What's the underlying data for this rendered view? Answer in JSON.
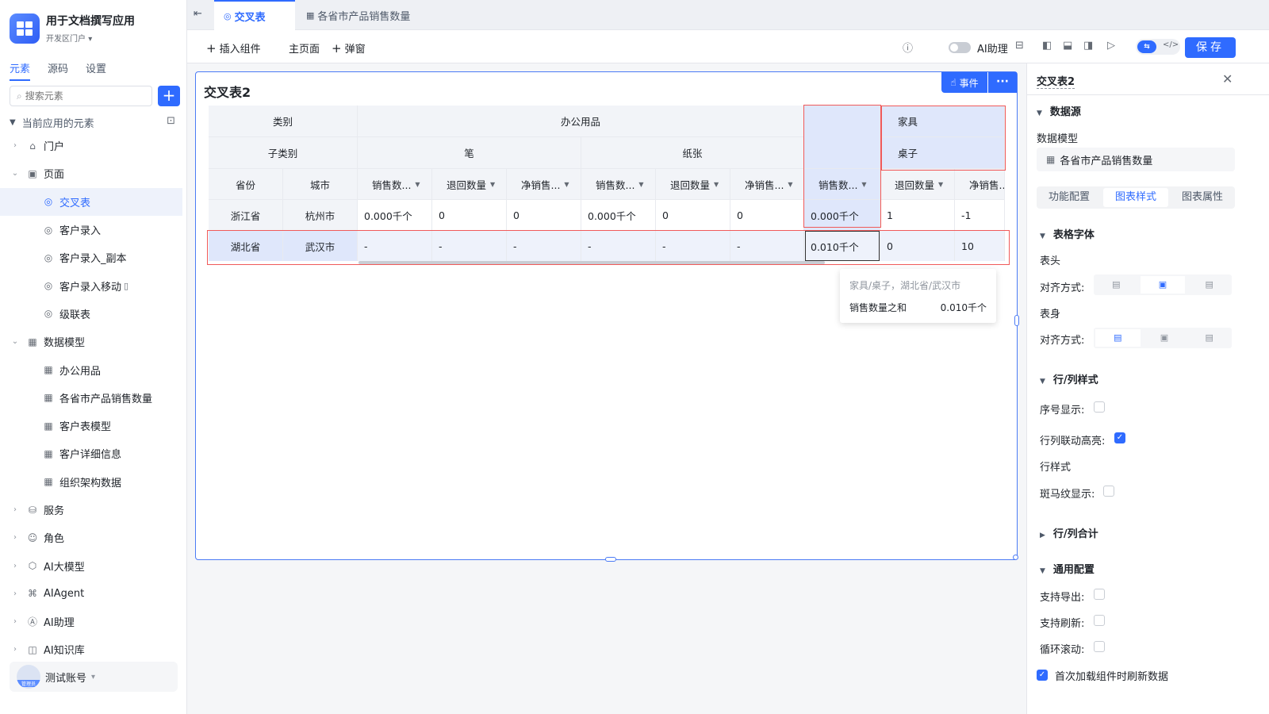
{
  "app": {
    "title": "用于文档撰写应用",
    "portal": "开发区门户"
  },
  "sidebar": {
    "tabs": [
      "元素",
      "源码",
      "设置"
    ],
    "search_placeholder": "搜索元素",
    "add": "+",
    "tree_root": "当前应用的元素",
    "items": [
      {
        "label": "门户",
        "icon": "portal-icon",
        "arrow": "›"
      },
      {
        "label": "页面",
        "icon": "page-icon",
        "arrow": "⌄"
      },
      {
        "label": "交叉表",
        "icon": "cross-table-icon"
      },
      {
        "label": "客户录入",
        "icon": "form-icon"
      },
      {
        "label": "客户录入_副本",
        "icon": "form-icon"
      },
      {
        "label": "客户录入移动",
        "icon": "form-icon"
      },
      {
        "label": "级联表",
        "icon": "form-icon"
      },
      {
        "label": "数据模型",
        "icon": "table-icon",
        "arrow": "⌄"
      },
      {
        "label": "办公用品",
        "icon": "table-icon"
      },
      {
        "label": "各省市产品销售数量",
        "icon": "table-icon"
      },
      {
        "label": "客户表模型",
        "icon": "table-icon"
      },
      {
        "label": "客户详细信息",
        "icon": "table-icon"
      },
      {
        "label": "组织架构数据",
        "icon": "table-icon"
      },
      {
        "label": "服务",
        "icon": "service-icon",
        "arrow": "›"
      },
      {
        "label": "角色",
        "icon": "role-icon",
        "arrow": "›"
      },
      {
        "label": "AI大模型",
        "icon": "ai-model-icon",
        "arrow": "›"
      },
      {
        "label": "AIAgent",
        "icon": "robot-icon",
        "arrow": "›"
      },
      {
        "label": "AI助理",
        "icon": "ai-assistant-icon",
        "arrow": "›"
      },
      {
        "label": "AI知识库",
        "icon": "book-icon",
        "arrow": "›"
      }
    ],
    "user": {
      "name": "测试账号",
      "role": "管理员"
    }
  },
  "tabs": [
    {
      "label": "交叉表",
      "active": true
    },
    {
      "label": "各省市产品销售数量",
      "active": false
    }
  ],
  "toolbar": {
    "insert": "插入组件",
    "home": "主页面",
    "popup": "弹窗",
    "ai_assist": "AI助理",
    "save": "保存"
  },
  "canvas": {
    "title": "交叉表2",
    "event_btn": "事件",
    "more_btn": "···",
    "table": {
      "h1": [
        "类别",
        "办公用品",
        "家具"
      ],
      "h2": [
        "子类别",
        "笔",
        "纸张",
        "桌子"
      ],
      "h3": [
        "省份",
        "城市",
        "销售数...",
        "退回数量",
        "净销售...",
        "销售数...",
        "退回数量",
        "净销售...",
        "销售数...",
        "退回数量",
        "净销售..."
      ],
      "rows": [
        [
          "浙江省",
          "杭州市",
          "0.000千个",
          "0",
          "0",
          "0.000千个",
          "0",
          "0",
          "0.000千个",
          "1",
          "-1"
        ],
        [
          "湖北省",
          "武汉市",
          "-",
          "-",
          "-",
          "-",
          "-",
          "-",
          "0.010千个",
          "0",
          "10"
        ]
      ]
    },
    "tooltip": {
      "title": "家具/桌子，湖北省/武汉市",
      "label": "销售数量之和",
      "value": "0.010千个"
    }
  },
  "right_panel": {
    "title": "交叉表2",
    "datasource": "数据源",
    "model_label": "数据模型",
    "model_value": "各省市产品销售数量",
    "tabs": [
      "功能配置",
      "图表样式",
      "图表属性"
    ],
    "font_section": "表格字体",
    "header": "表头",
    "align_label": "对齐方式:",
    "body": "表身",
    "rowcol_section": "行/列样式",
    "seq_label": "序号显示:",
    "highlight_label": "行列联动高亮:",
    "row_style": "行样式",
    "zebra_label": "斑马纹显示:",
    "total_section": "行/列合计",
    "general_section": "通用配置",
    "export_label": "支持导出:",
    "refresh_label": "支持刷新:",
    "loop_label": "循环滚动:",
    "first_load_label": "首次加载组件时刷新数据"
  }
}
